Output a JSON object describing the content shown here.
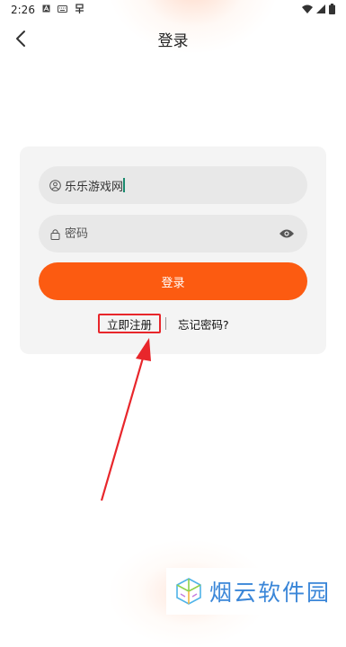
{
  "status_bar": {
    "time": "2:26",
    "icons_left": [
      "a-icon",
      "keyboard-icon",
      "app-icon"
    ],
    "icons_right": [
      "wifi-icon",
      "signal-icon",
      "battery-icon"
    ]
  },
  "header": {
    "title": "登录",
    "back_icon": "chevron-left-icon"
  },
  "form": {
    "username": {
      "value": "乐乐游戏网",
      "icon": "user-circle-icon"
    },
    "password": {
      "placeholder": "密码",
      "icon": "lock-icon",
      "toggle_icon": "eye-icon"
    },
    "login_button": "登录",
    "register_link": "立即注册",
    "divider": "|",
    "forgot_link": "忘记密码?"
  },
  "annotation": {
    "color": "#e8262b"
  },
  "watermark": {
    "text": "烟云软件园",
    "logo": "cube-logo"
  },
  "colors": {
    "accent": "#fc5b11",
    "field_bg": "#e8e8e8",
    "card_bg": "#f4f4f4"
  }
}
